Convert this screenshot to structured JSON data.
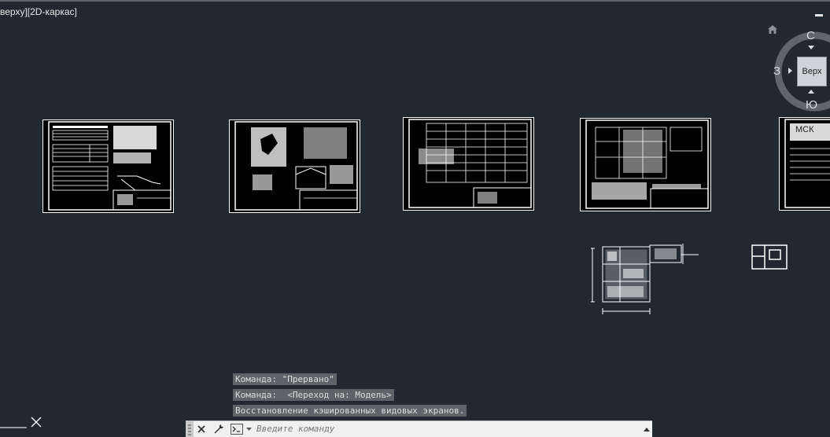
{
  "viewport": {
    "label": "верху][2D-каркас]"
  },
  "viewcube": {
    "north": "С",
    "south": "Ю",
    "west": "З",
    "top_face": "Верх"
  },
  "sheets": {
    "sheet5_label": "МСК"
  },
  "command_history": [
    "Команда: \"Прервано\"",
    "Команда:  <Переход на: Модель>",
    "Восстановление кэшированных видовых экранов."
  ],
  "command_line": {
    "placeholder": "Введите команду"
  },
  "icons": {
    "close": "close-icon",
    "customize": "wrench-icon",
    "prompt": "command-prompt-icon",
    "recent": "dropdown-arrow-icon",
    "history_up": "history-arrow-icon",
    "home": "home-icon",
    "ucs": "ucs-icon"
  }
}
